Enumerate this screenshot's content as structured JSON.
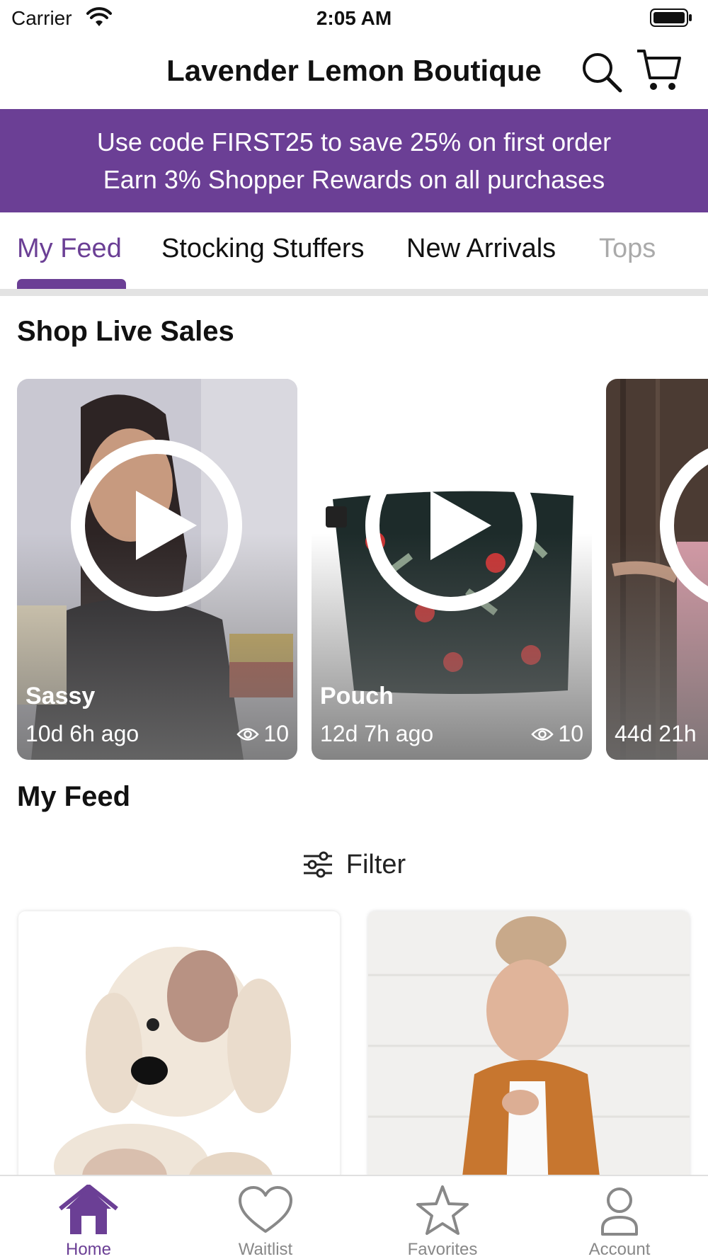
{
  "status_bar": {
    "carrier": "Carrier",
    "time": "2:05 AM"
  },
  "header": {
    "title": "Lavender Lemon Boutique",
    "search_icon": "search-icon",
    "cart_icon": "cart-icon"
  },
  "promo": {
    "line1": "Use code FIRST25 to save 25% on first order",
    "line2": "Earn 3% Shopper Rewards on all purchases"
  },
  "tabs": [
    {
      "label": "My Feed",
      "active": true
    },
    {
      "label": "Stocking Stuffers",
      "active": false
    },
    {
      "label": "New Arrivals",
      "active": false
    },
    {
      "label": "Tops",
      "active": false
    }
  ],
  "live_sales": {
    "title": "Shop Live Sales",
    "items": [
      {
        "name": "Sassy",
        "time": "10d 6h ago",
        "views": "10"
      },
      {
        "name": "Pouch",
        "time": "12d 7h ago",
        "views": "10"
      },
      {
        "name": "",
        "time": "44d 21h",
        "views": ""
      }
    ]
  },
  "feed": {
    "title": "My Feed",
    "filter_label": "Filter"
  },
  "bottom_nav": [
    {
      "label": "Home",
      "icon": "home-icon",
      "active": true
    },
    {
      "label": "Waitlist",
      "icon": "heart-icon",
      "active": false
    },
    {
      "label": "Favorites",
      "icon": "star-icon",
      "active": false
    },
    {
      "label": "Account",
      "icon": "account-icon",
      "active": false
    }
  ],
  "colors": {
    "accent": "#6b3f95",
    "inactive": "#888888"
  }
}
